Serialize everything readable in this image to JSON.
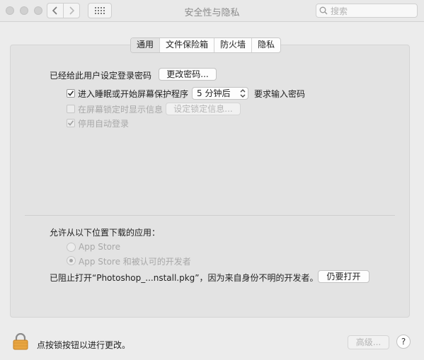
{
  "window": {
    "title": "安全性与隐私",
    "search_placeholder": "搜索"
  },
  "tabs": [
    {
      "label": "通用",
      "selected": true
    },
    {
      "label": "文件保险箱",
      "selected": false
    },
    {
      "label": "防火墙",
      "selected": false
    },
    {
      "label": "隐私",
      "selected": false
    }
  ],
  "general": {
    "password_set_label": "已经给此用户设定登录密码",
    "change_password_button": "更改密码...",
    "require_password": {
      "checked": true,
      "prefix": "进入睡眠或开始屏幕保护程序",
      "delay_value": "5 分钟后",
      "suffix": "要求输入密码"
    },
    "show_message": {
      "checked": false,
      "enabled": false,
      "label": "在屏幕锁定时显示信息",
      "button": "设定锁定信息..."
    },
    "disable_auto_login": {
      "checked": true,
      "enabled": false,
      "label": "停用自动登录"
    },
    "allow_apps_label": "允许从以下位置下载的应用：",
    "sources": [
      {
        "label": "App Store",
        "selected": false
      },
      {
        "label": "App Store 和被认可的开发者",
        "selected": true
      }
    ],
    "blocked_message": "已阻止打开“Photoshop_...nstall.pkg”，因为来自身份不明的开发者。",
    "open_anyway_button": "仍要打开"
  },
  "footer": {
    "lock_label": "点按锁按钮以进行更改。",
    "advanced_button": "高级...",
    "help_button": "?"
  },
  "colors": {
    "window_bg": "#ececec",
    "panel_bg": "#e3e3e3",
    "lock_body": "#e8a542",
    "disabled_text": "#a8a8a8"
  }
}
